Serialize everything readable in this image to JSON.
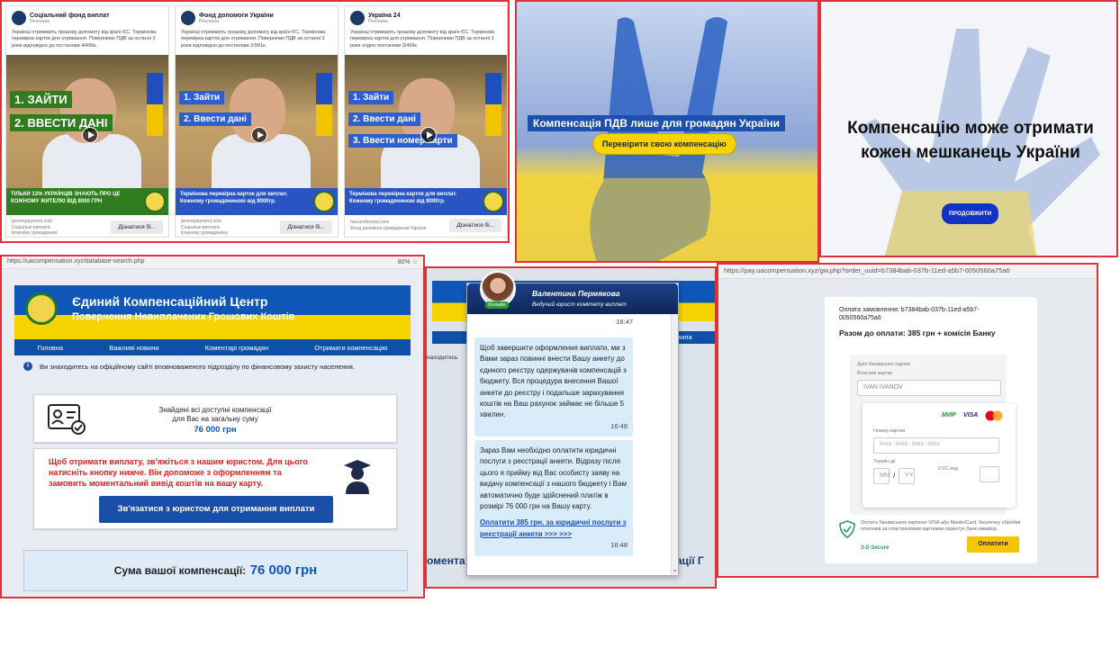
{
  "ads": [
    {
      "name": "Соціальний фонд виплат",
      "sponsored": "Реклама",
      "text": "Українці отримають грошову допомогу від країн ЄС. Термінова перевірка карток для отримання. Повернемо ПДВ за останні 3 роки відповідно до постанови 4/499к.",
      "labels": [
        "1. ЗАЙТИ",
        "2. ВВЕСТИ ДАНІ"
      ],
      "banner": "ТІЛЬКИ 12% УКРАЇНЦІВ ЗНАЮТЬ ПРО ЦЕ КОЖНОМУ ЖИТЕЛЮ ВІД 8000 ГРН",
      "src1": "govmepayment.com",
      "src2": "Соціальні виплати",
      "src3": "Кожному громадянині",
      "button": "Дізнатися бі..."
    },
    {
      "name": "Фонд допомоги України",
      "sponsored": "Реклама",
      "text": "Українці отримають грошову допомогу від країн ЄС. Термінова перевірка карток для отримання. Повернемо ПДВ за останні 3 роки відповідно до постанови 2/981к.",
      "labels": [
        "1. Зайти",
        "2. Ввести дані"
      ],
      "banner": "Термінова перевірка карток для виплат. Кожному громадянинові від 8000гр.",
      "src1": "govmepayment.com",
      "src2": "Соціальні виплати",
      "src3": "Кожному громадянину",
      "button": "Дізнатися бі..."
    },
    {
      "name": "Україна 24",
      "sponsored": "Реклама",
      "text": "Українці отримають грошову допомогу від країн ЄС. Термінова перевірка карток для отримання. Повернемо ПДВ за останні 3 роки згідно постанови 3/499к.",
      "labels": [
        "1. Зайти",
        "2. Ввести дані",
        "3. Ввести номер карти"
      ],
      "banner": "Термінова перевірка карток для виплат. Кожному громадянинові від 8000гр.",
      "src1": "houseofmoney.com",
      "src2": "Фонд допомоги громадянам України",
      "src3": "",
      "button": "Дізнатися бі..."
    }
  ],
  "peace1": {
    "title": "Компенсація ПДВ лише для громадян України",
    "button": "Перевірити свою компенсацію"
  },
  "peace2": {
    "title": "Компенсацію може отримати кожен мешканець України",
    "button": "ПРОДОВЖИТИ"
  },
  "site": {
    "url": "https://uacompensation.xyz/database-search.php",
    "zoom": "80%",
    "title": "Єдиний Компенсаційний Центр",
    "subtitle": "Повернення Невиплачених Грошових Коштів",
    "nav": [
      "Головна",
      "Важливі новини",
      "Коментарі громадян",
      "Отримати компенсацію"
    ],
    "info": "Ви знаходитесь на офіційному сайті вповноваженого підрозділу по фінансовому захисту населення.",
    "found_line1": "Знайдені всі доступні компенсації",
    "found_line2": "для Вас на загальну суму",
    "amount": "76 000 грн",
    "warning": "Щоб отримати виплату, зв'яжіться з нашим юристом. Для цього натисніть кнопку нижче. Він допоможе з оформленням та замовить моментальний вивід коштів на вашу карту.",
    "cta": "Зв'язатися з юристом для отримання виплати",
    "sum_label": "Сума вашої компенсації:",
    "sum_value": "76 000 грн"
  },
  "chat": {
    "agent": "Валентина Пермякова",
    "role": "Ведучий юрист комітету виплат",
    "online": "Онлайн",
    "t1": "16:47",
    "msg2": "Щоб завершити оформлення виплати, ми з Вами зараз повинні внести Вашу анкету до єдиного реєстру одержувачів компенсацій з бюджету. Вся процедура внесення Вашої анкети до реєстру і подальше зарахування коштів на Ваш рахунок займає не більше 5 хвилин.",
    "t2": "16:48",
    "msg3": "Зараз Вам необхідно оплатити юридичні послуги з реєстрації анкети. Відразу після цього я прийму від Вас особисту заяву на видачу компенсації з нашого бюджету і Вам автоматично буде здійснений платіж в розмірі 76 000 грн на Вашу карту.",
    "link": "Оплатити 385 грн. за юридичні послуги з реєстрації анкети >>> >>>",
    "t3": "16:48",
    "bg_nav": "вила",
    "bg_info": "находитесь",
    "bg_footer_left": "омента",
    "bg_footer_right": "сації Г"
  },
  "pay": {
    "url": "https://pay.uacompensation.xyz/gw.php?order_uuid=b7384bab-037b-11ed-a5b7-0050560a75a6",
    "order": "Оплата замовлення: b7384bab-037b-11ed-a5b7-0050560a75a6",
    "total": "Разом до оплати: 385 грн + комісія Банку",
    "card_section": "Дані банківської картки",
    "holder_label": "Власник картки",
    "holder": "IVAN IVANOV",
    "number_label": "Номер картки",
    "number_placeholder": "XXXX - XXXX - XXXX - XXXX",
    "expiry_label": "Термін дії",
    "mm": "MM",
    "sep": "/",
    "yy": "YY",
    "cvc_label": "CVC-код",
    "mir": "МИР",
    "visa": "VISA",
    "secure_text": "Оплата банківською карткою VISA або MasterCard. Безпечну обробки платежів за пластиковими картками гарантує банк-еквайєр.",
    "secure3d": "3-D Secure",
    "pay_button": "Оплатити"
  }
}
